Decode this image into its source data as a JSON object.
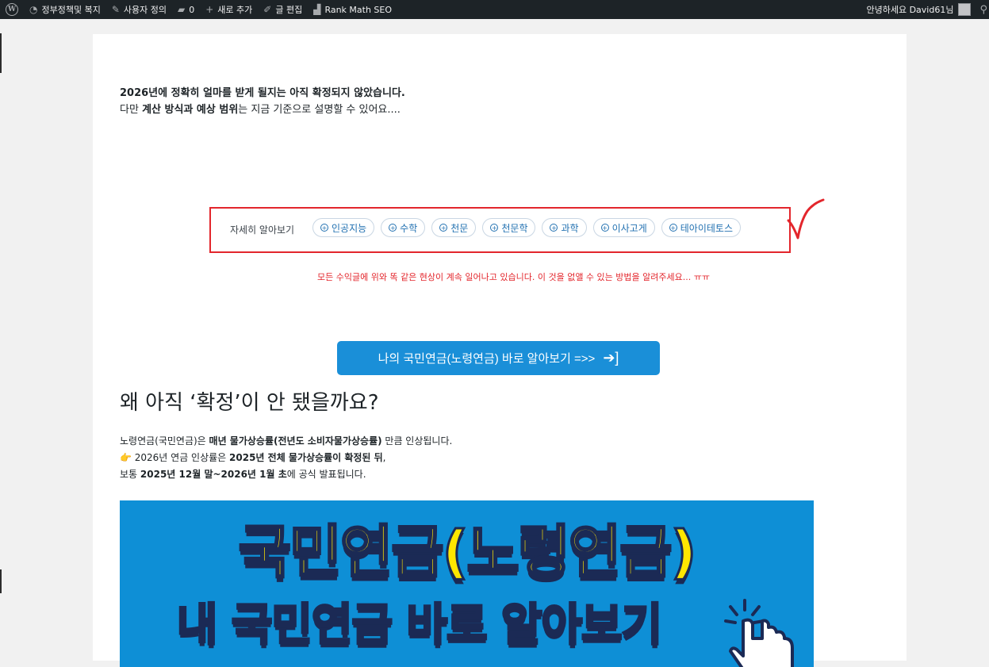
{
  "adminbar": {
    "site_name": "정부정책및 복지",
    "customize": "사용자 정의",
    "comments_count": "0",
    "new_label": "새로 추가",
    "edit_post": "글 편집",
    "rankmath": "Rank Math SEO",
    "greeting": "안녕하세요 David61님"
  },
  "intro": {
    "line1": "2026년에 정확히 얼마를 받게 될지는 아직 확정되지 않았습니다.",
    "line2_prefix": "다만 ",
    "line2_bold": "계산 방식과 예상 범위",
    "line2_suffix": "는 지금 기준으로 설명할 수 있어요...."
  },
  "tags": {
    "label": "자세히 알아보기",
    "items": [
      "인공지능",
      "수학",
      "천문",
      "천문학",
      "과학",
      "이사고게",
      "테아이테토스"
    ]
  },
  "warning_note": "모든 수익글에 위와 똑 같은 현상이 계속 일어나고 있습니다.   이 것을 없앨 수 있는 방법을 알려주세요... ㅠㅠ",
  "cta": {
    "label": "나의 국민연금(노령연금) 바로 알아보기 =>>"
  },
  "heading": "왜 아직 ‘확정’이 안 됐을까요?",
  "body": {
    "l1_a": "노령연금(국민연금)은 ",
    "l1_b": "매년 물가상승률(전년도 소비자물가상승률)",
    "l1_c": " 만큼 인상됩니다.",
    "l2_icon": "👉",
    "l2_a": " 2026년 연금 인상률은 ",
    "l2_b": "2025년 전체 물가상승률이 확정된 뒤",
    "l2_c": ",",
    "l3_a": "보통 ",
    "l3_b": "2025년 12월 말~2026년 1월 초",
    "l3_c": "에 공식 발표됩니다."
  },
  "banner": {
    "line1": "국민연금(노령연금)",
    "line2": "내 국민연금 바로 알아보기"
  },
  "colors": {
    "adminbar": "#1d2327",
    "annotation_red": "#e3262c",
    "cta_blue": "#1a8fd8",
    "banner_blue": "#0e8fd6",
    "banner_yellow": "#ffe600"
  }
}
